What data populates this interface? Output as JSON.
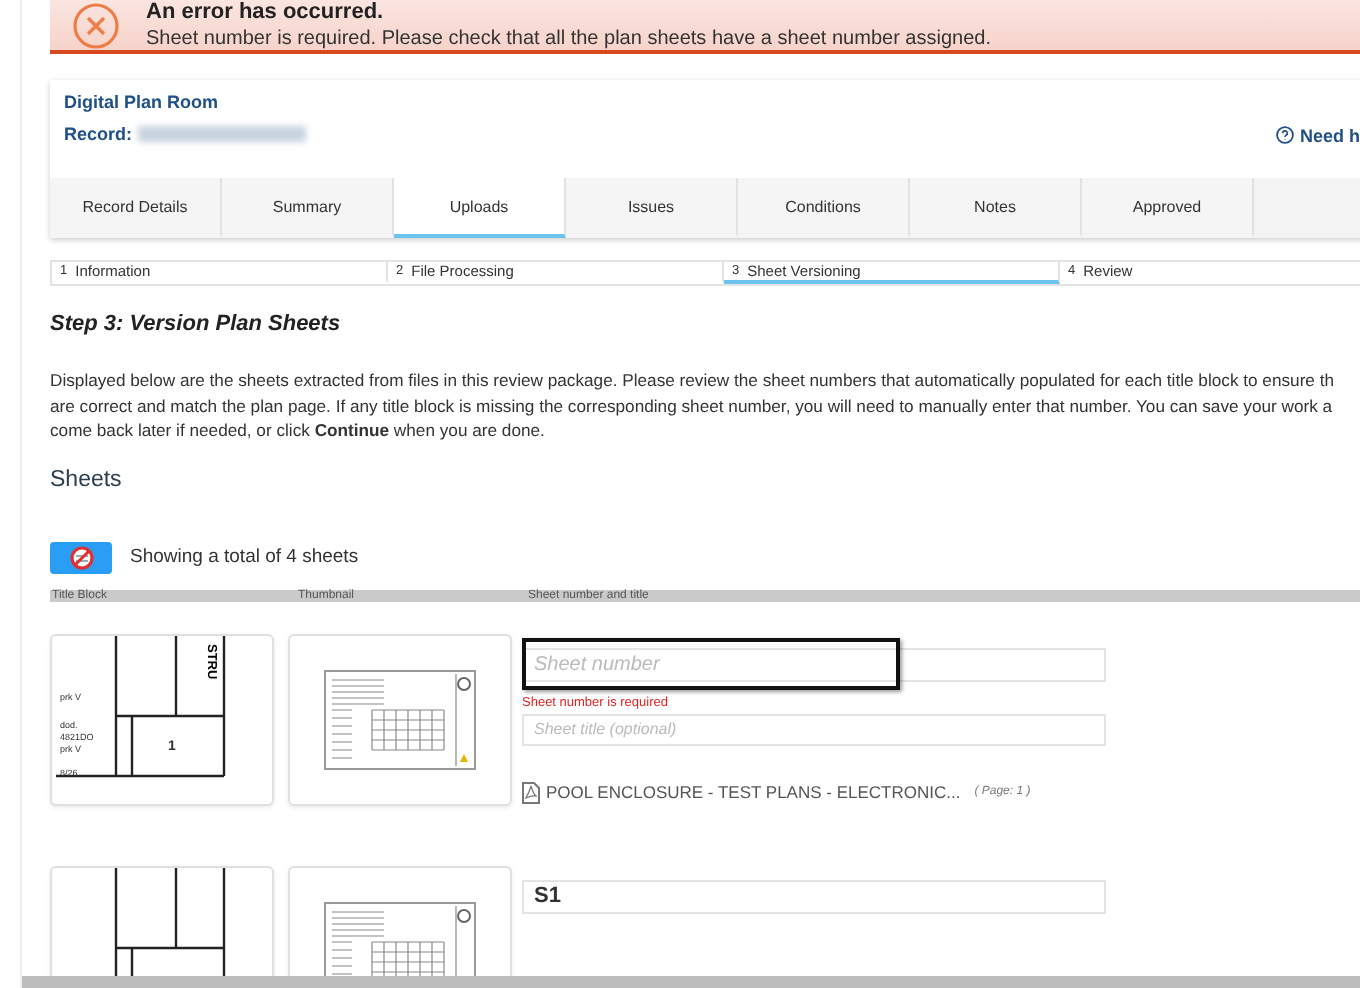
{
  "error": {
    "title": "An error has occurred.",
    "message": "Sheet number is required. Please check that all the plan sheets have a sheet number assigned."
  },
  "header": {
    "title": "Digital Plan Room",
    "record_label": "Record:",
    "help": "Need h"
  },
  "tabs": [
    {
      "label": "Record Details",
      "selected": false
    },
    {
      "label": "Summary",
      "selected": false
    },
    {
      "label": "Uploads",
      "selected": true
    },
    {
      "label": "Issues",
      "selected": false
    },
    {
      "label": "Conditions",
      "selected": false
    },
    {
      "label": "Notes",
      "selected": false
    },
    {
      "label": "Approved",
      "selected": false
    }
  ],
  "steps": [
    {
      "number": "1",
      "label": "Information",
      "selected": false
    },
    {
      "number": "2",
      "label": "File Processing",
      "selected": false
    },
    {
      "number": "3",
      "label": "Sheet Versioning",
      "selected": true
    },
    {
      "number": "4",
      "label": "Review",
      "selected": false
    }
  ],
  "step_heading": "Step 3: Version Plan Sheets",
  "intro_lines": [
    "Displayed below are the sheets extracted from files in this review package. Please review the sheet numbers that automatically populated for each title block to ensure th",
    "are correct and match the plan page. If any title block is missing the corresponding sheet number, you will need to manually enter that number. You can save your work a",
    "come back later if needed, or click **Continue** when you are done."
  ],
  "sheets": {
    "title": "Sheets",
    "count_text": "Showing a total of 4 sheets",
    "columns": [
      "Title Block",
      "Thumbnail",
      "Sheet number and title"
    ],
    "rows": [
      {
        "title_block_texts": [
          "prk V",
          "dod.",
          "4821DO",
          "prk V",
          "8/26",
          "STRU",
          "1"
        ],
        "number_placeholder": "Sheet number",
        "number_value": "",
        "highlighted": true,
        "error": "Sheet number is required",
        "title_placeholder": "Sheet title (optional)",
        "file_name": "POOL ENCLOSURE - TEST PLANS - ELECTRONIC...",
        "page": "( Page: 1 )"
      },
      {
        "title_block_texts": [],
        "number_value": "S1",
        "highlighted": false
      }
    ]
  }
}
